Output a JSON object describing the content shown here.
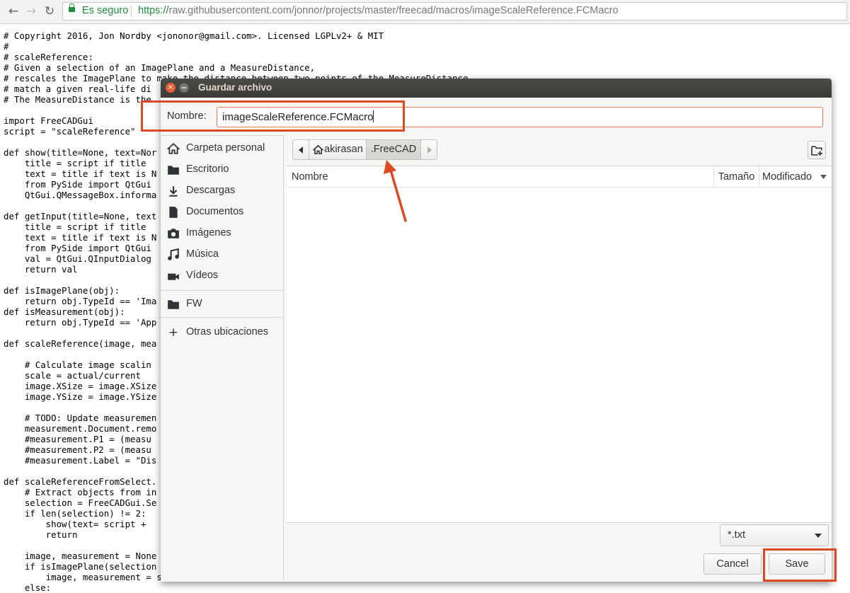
{
  "browser": {
    "secure_label": "Es seguro",
    "url_scheme": "https://",
    "url_rest": "raw.githubusercontent.com/jonnor/projects/master/freecad/macros/imageScaleReference.FCMacro"
  },
  "code": "# Copyright 2016, Jon Nordby <jononor@gmail.com>. Licensed LGPLv2+ & MIT\n#\n# scaleReference:\n# Given a selection of an ImagePlane and a MeasureDistance,\n# rescales the ImagePlane to make the distance between two points of the MeasureDistance\n# match a given real-life di\n# The MeasureDistance is the\n\nimport FreeCADGui\nscript = \"scaleReference\"\n\ndef show(title=None, text=Nor\n    title = script if title\n    text = title if text is N\n    from PySide import QtGui\n    QtGui.QMessageBox.informa\n\ndef getInput(title=None, text\n    title = script if title\n    text = title if text is N\n    from PySide import QtGui\n    val = QtGui.QInputDialog\n    return val\n\ndef isImagePlane(obj):\n    return obj.TypeId == 'Ima\ndef isMeasurement(obj):\n    return obj.TypeId == 'App\n\ndef scaleReference(image, mea\n\n    # Calculate image scalin\n    scale = actual/current\n    image.XSize = image.XSize\n    image.YSize = image.YSize\n\n    # TODO: Update measuremen\n    measurement.Document.remo\n    #measurement.P1 = (measu\n    #measurement.P2 = (measu\n    #measurement.Label = \"Dis\n\ndef scaleReferenceFromSelect.\n    # Extract objects from in\n    selection = FreeCADGui.Se\n    if len(selection) != 2:\n        show(text= script +\n        return\n\n    image, measurement = None\n    if isImagePlane(selection\n        image, measurement = selection\n    else:",
  "dialog": {
    "title": "Guardar archivo",
    "name_label": "Nombre:",
    "name_value": "imageScaleReference.FCMacro",
    "sidebar": [
      {
        "label": "Carpeta personal",
        "icon": "home-icon"
      },
      {
        "label": "Escritorio",
        "icon": "desktop-folder-icon"
      },
      {
        "label": "Descargas",
        "icon": "download-icon"
      },
      {
        "label": "Documentos",
        "icon": "document-icon"
      },
      {
        "label": "Imágenes",
        "icon": "camera-icon"
      },
      {
        "label": "Música",
        "icon": "music-icon"
      },
      {
        "label": "Vídeos",
        "icon": "video-icon"
      },
      {
        "label": "FW",
        "icon": "folder-icon"
      },
      {
        "label": "Otras ubicaciones",
        "icon": "plus-icon"
      }
    ],
    "path": [
      "akirasan",
      ".FreeCAD"
    ],
    "columns": {
      "name": "Nombre",
      "size": "Tamaño",
      "modified": "Modificado"
    },
    "filter": "*.txt",
    "cancel": "Cancel",
    "save": "Save"
  },
  "colors": {
    "highlight": "#dd4a22",
    "secure_green": "#1e8e3e",
    "titlebar": "#3c3b37"
  }
}
